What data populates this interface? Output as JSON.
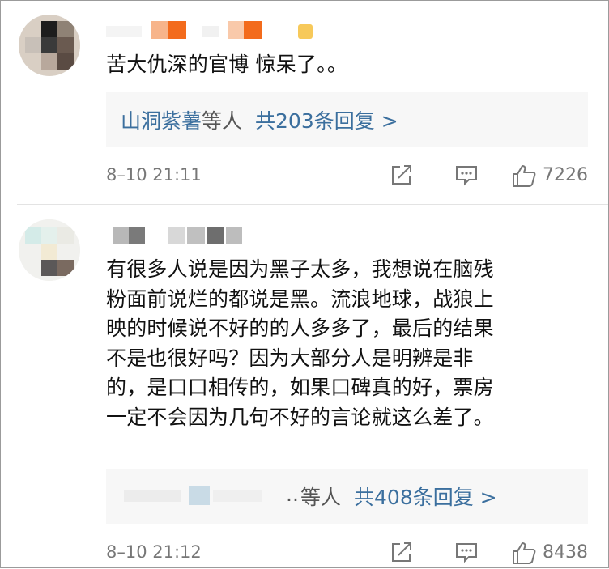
{
  "comments": [
    {
      "text_lines": [
        "苦大仇深的官博 惊呆了。。"
      ],
      "reply_preview": {
        "names": "山洞紫薯",
        "suffix": "等人",
        "count_label": "共203条回复 >"
      },
      "time": "8–10 21:11",
      "likes": "7226"
    },
    {
      "text_lines": [
        "有很多人说是因为黑子太多，我想说在脑残",
        "粉面前说烂的都说是黑。流浪地球，战狼上",
        "映的时候说不好的的人多多了，最后的结果",
        "不是也很好吗？因为大部分人是明辨是非",
        "的，是口口相传的，如果口碑真的好，票房",
        "一定不会因为几句不好的言论就这么差了。"
      ],
      "reply_preview": {
        "names": "..",
        "suffix": "等人",
        "count_label": "共408条回复 >"
      },
      "time": "8–10 21:12",
      "likes": "8438"
    }
  ],
  "colors": {
    "link": "#3b6f9e",
    "meta": "#777777",
    "reply_bg": "#f7f7f7",
    "name_blur_orange": "#f36b1c"
  },
  "icons": [
    "share-icon",
    "comment-icon",
    "like-icon"
  ]
}
